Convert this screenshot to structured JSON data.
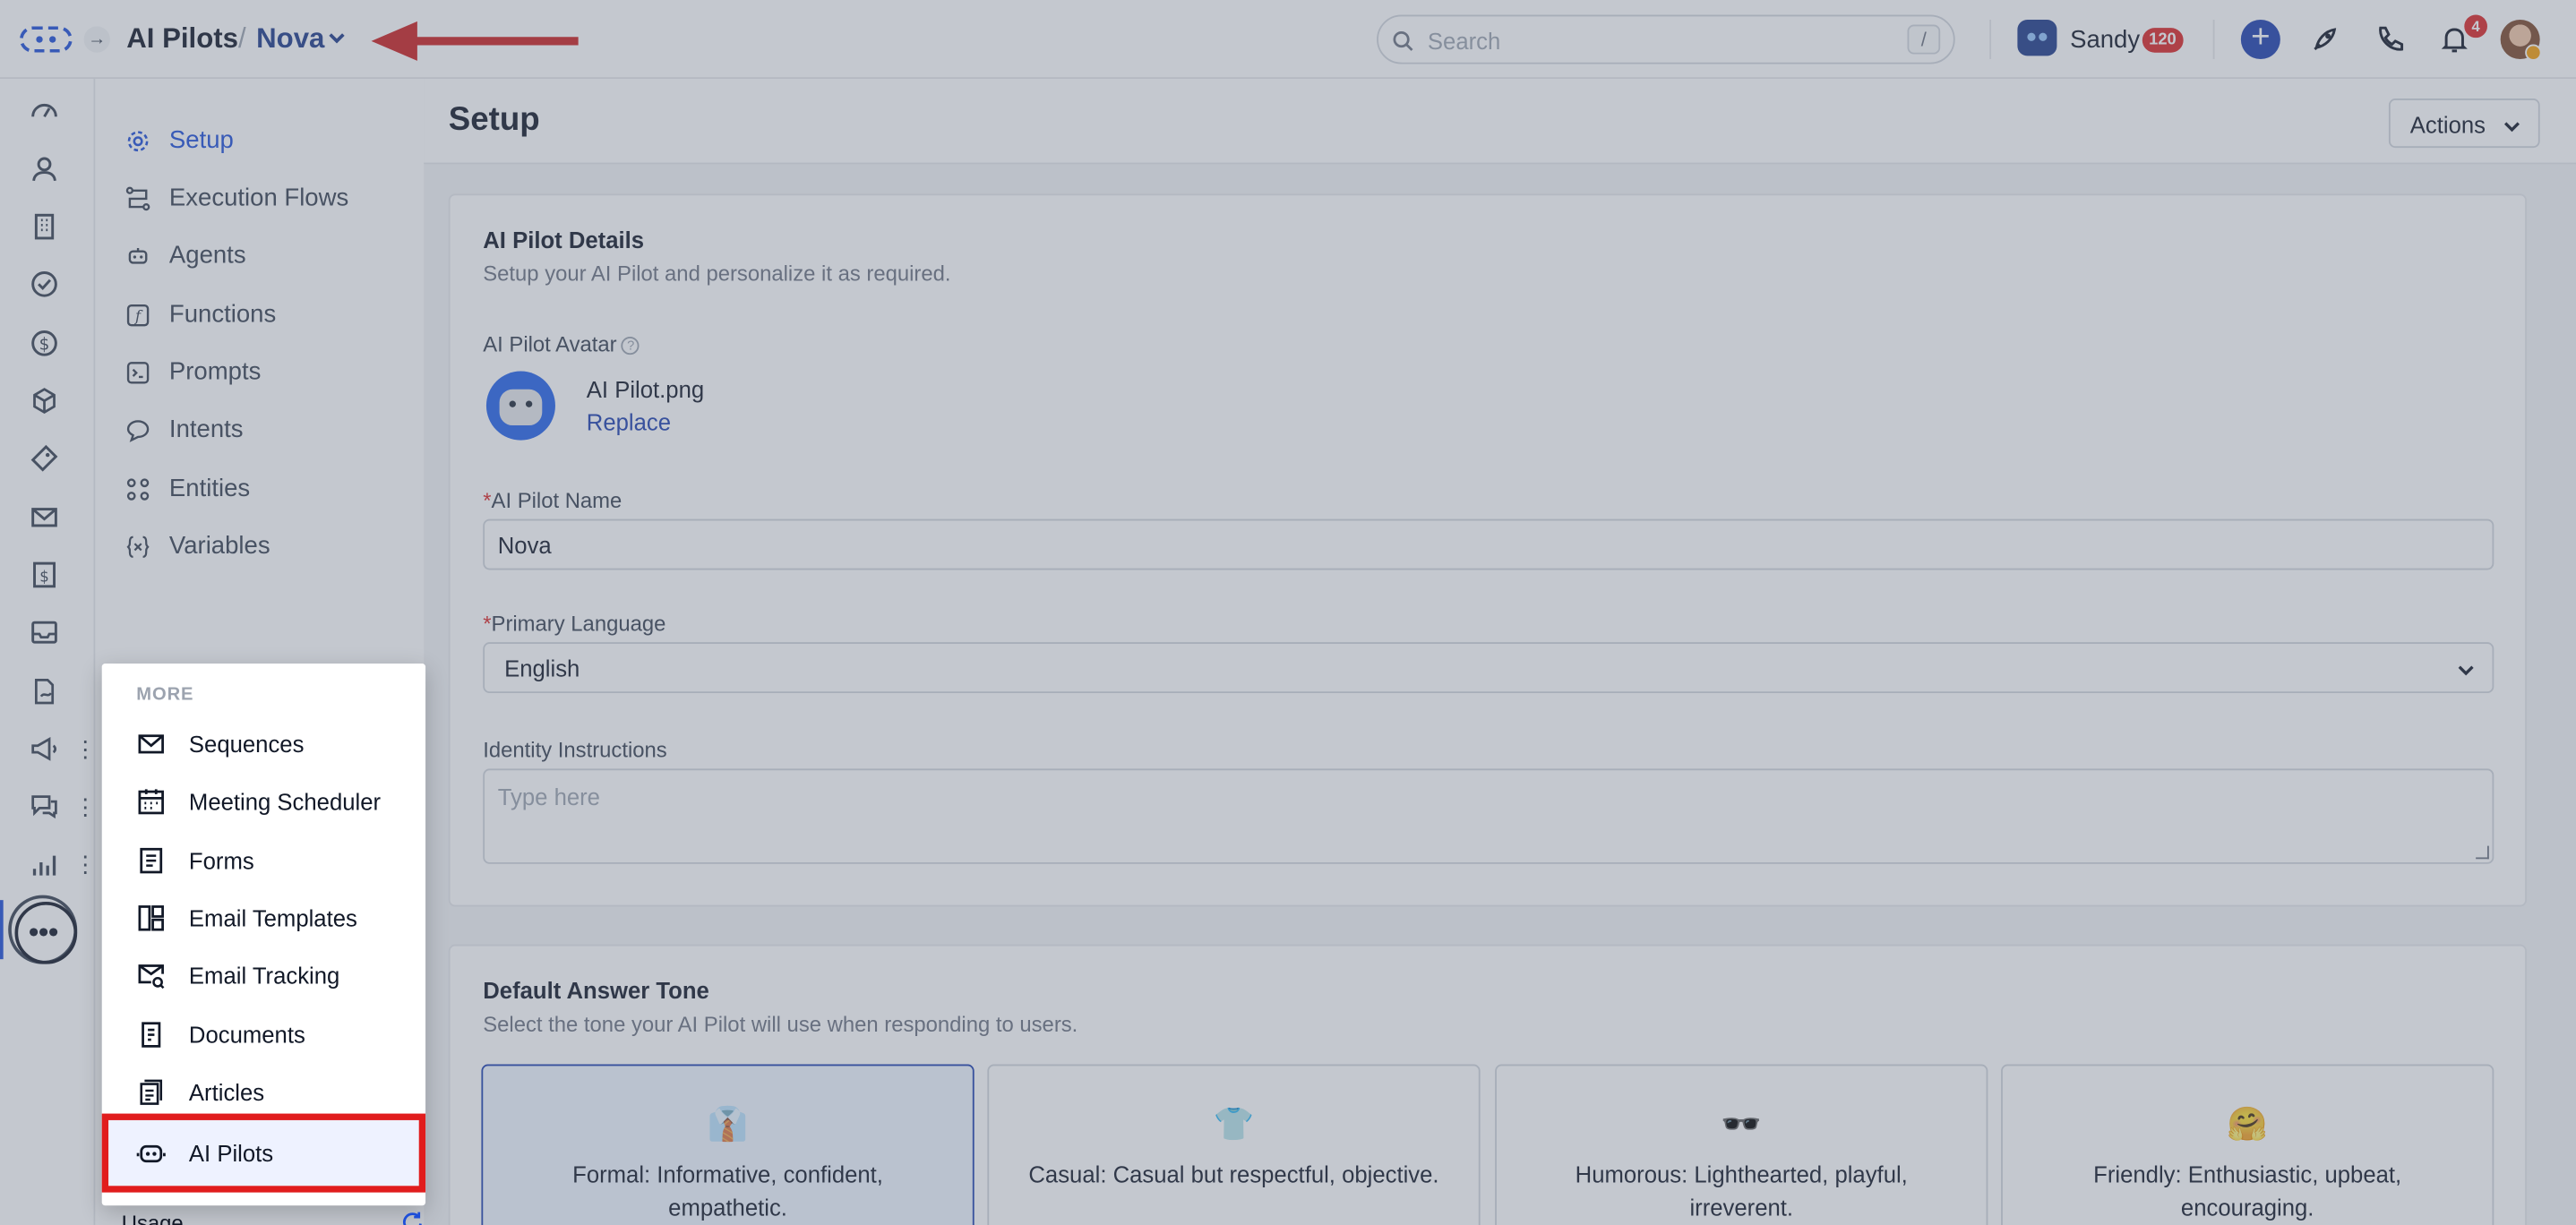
{
  "header": {
    "breadcrumb_root": "AI Pilots",
    "breadcrumb_sep": "/",
    "breadcrumb_current": "Nova",
    "search_placeholder": "Search",
    "search_shortcut": "/",
    "user_name": "Sandy",
    "credits": "120",
    "notification_count": "4"
  },
  "subnav": {
    "items": [
      {
        "label": "Setup",
        "icon": "gear-icon",
        "active": true
      },
      {
        "label": "Execution Flows",
        "icon": "flow-icon"
      },
      {
        "label": "Agents",
        "icon": "agents-icon"
      },
      {
        "label": "Functions",
        "icon": "function-icon"
      },
      {
        "label": "Prompts",
        "icon": "terminal-icon"
      },
      {
        "label": "Intents",
        "icon": "chat-bubble-icon"
      },
      {
        "label": "Entities",
        "icon": "entities-icon"
      },
      {
        "label": "Variables",
        "icon": "variable-icon"
      }
    ]
  },
  "page": {
    "title": "Setup",
    "actions_label": "Actions"
  },
  "details": {
    "title": "AI Pilot Details",
    "subtitle": "Setup your AI Pilot and personalize it as required.",
    "avatar_label": "AI Pilot Avatar",
    "avatar_file": "AI Pilot.png",
    "replace_label": "Replace",
    "name_label": "AI Pilot Name",
    "name_value": "Nova",
    "language_label": "Primary Language",
    "language_value": "English",
    "identity_label": "Identity Instructions",
    "identity_placeholder": "Type here",
    "required_mark": "*"
  },
  "tone": {
    "title": "Default Answer Tone",
    "subtitle": "Select the tone your AI Pilot will use when responding to users.",
    "options": [
      {
        "emoji": "👔",
        "text": "Formal: Informative, confident, empathetic.",
        "selected": true
      },
      {
        "emoji": "👕",
        "text": "Casual: Casual but respectful, objective."
      },
      {
        "emoji": "🕶️",
        "text": "Humorous: Lighthearted, playful, irreverent."
      },
      {
        "emoji": "🤗",
        "text": "Friendly: Enthusiastic, upbeat, encouraging."
      }
    ]
  },
  "more_menu": {
    "heading": "MORE",
    "items": [
      {
        "label": "Sequences",
        "icon": "mail-icon"
      },
      {
        "label": "Meeting Scheduler",
        "icon": "calendar-icon"
      },
      {
        "label": "Forms",
        "icon": "form-icon"
      },
      {
        "label": "Email Templates",
        "icon": "template-icon"
      },
      {
        "label": "Email Tracking",
        "icon": "email-tracking-icon"
      },
      {
        "label": "Documents",
        "icon": "document-icon"
      },
      {
        "label": "Articles",
        "icon": "article-icon"
      },
      {
        "label": "AI Pilots",
        "icon": "ai-pilot-icon",
        "highlighted": true
      }
    ]
  },
  "rail": {
    "icons": [
      "dashboard-icon",
      "contacts-icon",
      "companies-icon",
      "tasks-icon",
      "deals-icon",
      "products-icon",
      "tickets-icon",
      "email-icon",
      "invoice-icon",
      "inbox-icon",
      "documents-sign-icon",
      "campaigns-icon",
      "conversations-icon",
      "reports-icon",
      "more-icon"
    ]
  },
  "peek": {
    "usage_label": "Usage"
  },
  "colors": {
    "accent": "#1d4ed8",
    "highlight_border": "#e11d1d",
    "annotation_arrow": "#cc1f1f"
  }
}
